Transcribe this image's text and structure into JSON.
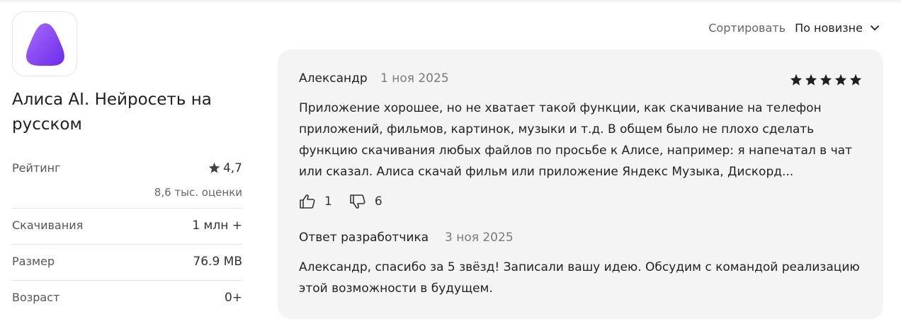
{
  "app": {
    "icon": "alice-app-icon",
    "title": "Алиса AI. Нейросеть на русском"
  },
  "info": {
    "rating_label": "Рейтинг",
    "rating_value": "4,7",
    "rating_count": "8,6 тыс. оценки",
    "downloads_label": "Скачивания",
    "downloads_value": "1 млн +",
    "size_label": "Размер",
    "size_value": "76.9 MB",
    "age_label": "Возраст",
    "age_value": "0+"
  },
  "sort": {
    "label": "Сортировать",
    "value": "По новизне"
  },
  "review": {
    "author": "Александр",
    "date": "1 ноя 2025",
    "stars": 5,
    "text": "Приложение хорошее, но не хватает такой функции, как скачивание на телефон приложений, фильмов, картинок, музыки и т.д. В общем было не плохо сделать функцию скачивания любых файлов по просьбе к Алисе, например: я напечатал в чат или сказал. Алиса скачай фильм или приложение Яндекс Музыка, Дискорд...",
    "likes": "1",
    "dislikes": "6",
    "developer_reply": {
      "title": "Ответ разработчика",
      "date": "3 ноя 2025",
      "text": "Александр, спасибо за 5 звёзд! Записали вашу идею. Обсудим с командой реализацию этой возможности в будущем."
    }
  },
  "colors": {
    "accent_purple": "#7b3ff2",
    "card_background": "#f4f4f4"
  }
}
